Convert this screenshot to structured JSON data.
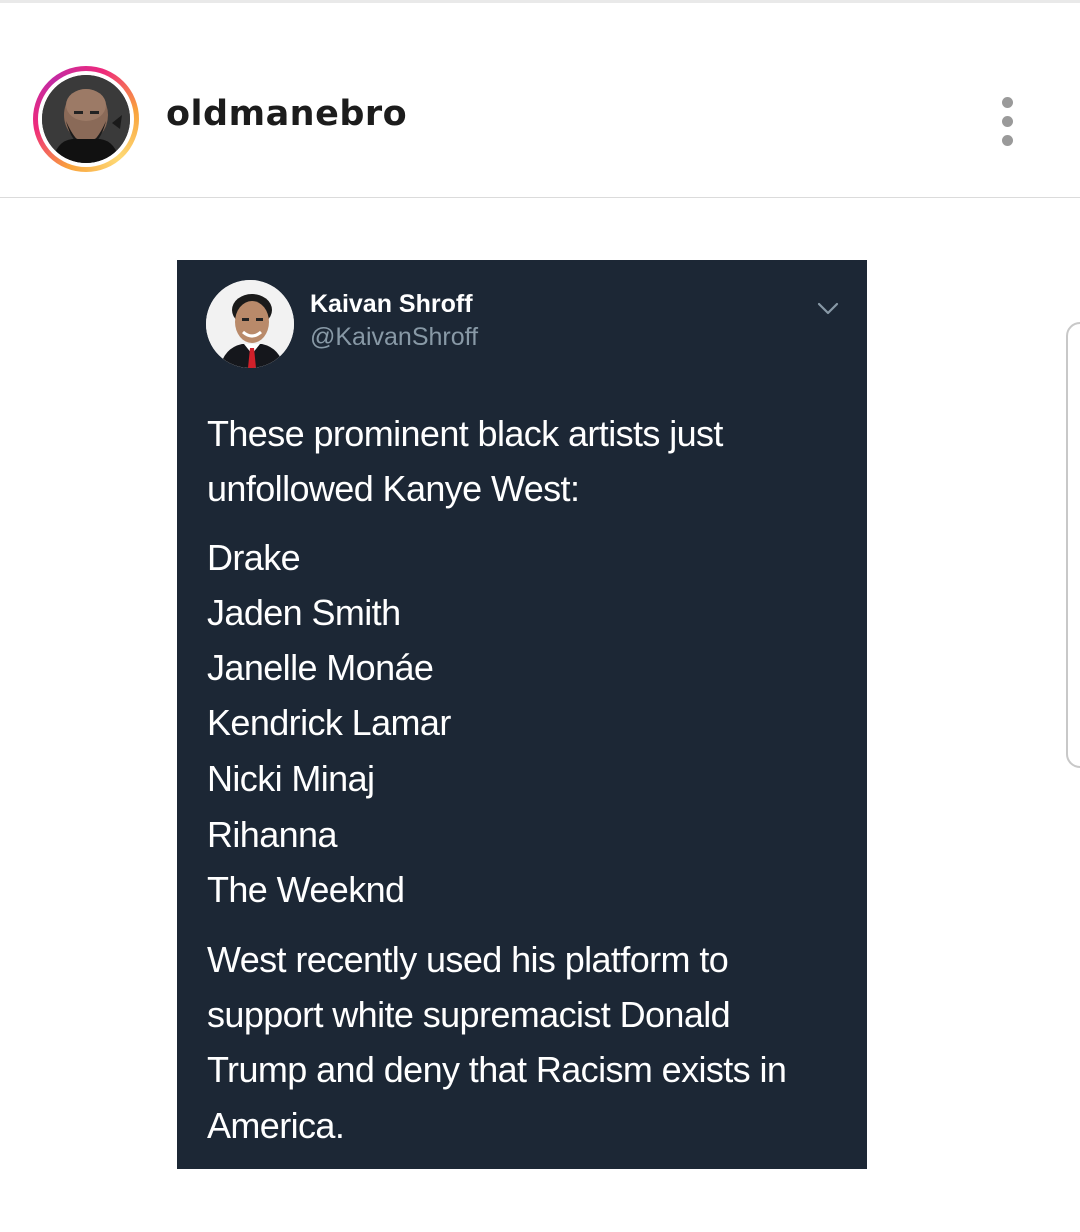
{
  "post": {
    "username": "oldmanebro"
  },
  "tweet": {
    "author_name": "Kaivan Shroff",
    "author_handle": "@KaivanShroff",
    "intro_lines": [
      "These prominent black artists just",
      "unfollowed Kanye West:"
    ],
    "artists": [
      "Drake",
      "Jaden Smith",
      "Janelle Monáe",
      "Kendrick Lamar",
      "Nicki Minaj",
      "Rihanna",
      "The Weeknd"
    ],
    "closing_lines": [
      "West recently used his platform to",
      "support white supremacist Donald",
      "Trump and deny that Racism exists in",
      "America."
    ]
  },
  "colors": {
    "tweet_background": "#1c2735",
    "tweet_handle": "#8899a6",
    "username_text": "#1c1c1c"
  },
  "icons": {
    "more": "vertical-ellipsis-icon",
    "tweet_menu": "chevron-down-icon"
  }
}
